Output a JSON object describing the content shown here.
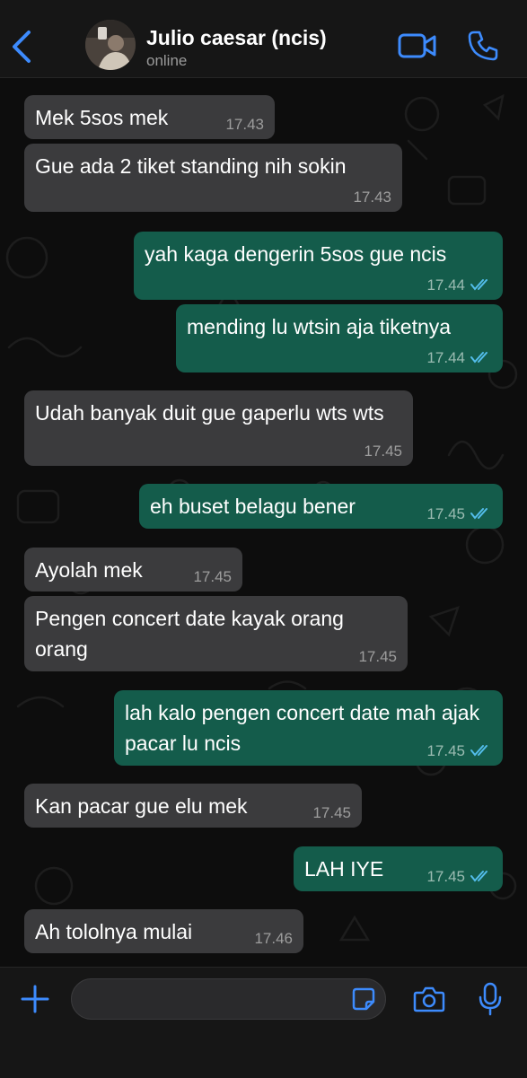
{
  "header": {
    "contact_name": "Julio caesar (ncis)",
    "status": "online"
  },
  "icons": {
    "back": "chevron-left-icon",
    "video": "video-camera-icon",
    "phone": "phone-icon",
    "plus": "plus-icon",
    "sticker": "sticker-icon",
    "camera": "camera-icon",
    "mic": "microphone-icon"
  },
  "colors": {
    "accent": "#3d8bfd",
    "incoming_bubble": "#3b3b3d",
    "outgoing_bubble": "#145c4b",
    "read_ticks": "#53bdeb"
  },
  "messages": [
    {
      "dir": "in",
      "text": "Mek 5sos mek",
      "time": "17.43"
    },
    {
      "dir": "in",
      "text": "Gue ada 2 tiket standing nih sokin",
      "time": "17.43"
    },
    {
      "dir": "out",
      "text": "yah kaga dengerin 5sos gue ncis",
      "time": "17.44",
      "read": true
    },
    {
      "dir": "out",
      "text": "mending lu wtsin aja tiketnya",
      "time": "17.44",
      "read": true
    },
    {
      "dir": "in",
      "text": "Udah banyak duit gue gaperlu wts wts",
      "time": "17.45"
    },
    {
      "dir": "out",
      "text": "eh buset belagu bener",
      "time": "17.45",
      "read": true
    },
    {
      "dir": "in",
      "text": "Ayolah mek",
      "time": "17.45"
    },
    {
      "dir": "in",
      "text": "Pengen concert date kayak orang orang",
      "time": "17.45"
    },
    {
      "dir": "out",
      "text": "lah kalo pengen concert date mah ajak pacar lu ncis",
      "time": "17.45",
      "read": true
    },
    {
      "dir": "in",
      "text": "Kan pacar gue elu mek",
      "time": "17.45"
    },
    {
      "dir": "out",
      "text": "LAH IYE",
      "time": "17.45",
      "read": true
    },
    {
      "dir": "in",
      "text": "Ah tololnya mulai",
      "time": "17.46"
    }
  ],
  "composer": {
    "input_value": ""
  }
}
